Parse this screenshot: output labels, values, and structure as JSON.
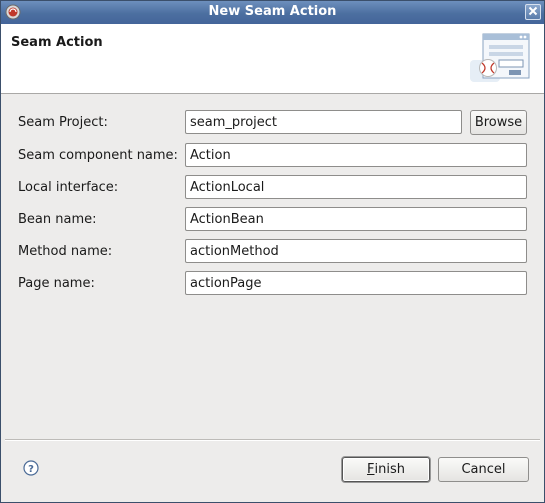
{
  "window": {
    "title": "New Seam Action"
  },
  "banner": {
    "title": "Seam Action",
    "image_icon": "seam-wizard-banner-icon"
  },
  "form": {
    "fields": [
      {
        "label": "Seam Project:",
        "value": "seam_project"
      },
      {
        "label": "Seam component name:",
        "value": "Action"
      },
      {
        "label": "Local interface:",
        "value": "ActionLocal"
      },
      {
        "label": "Bean name:",
        "value": "ActionBean"
      },
      {
        "label": "Method name:",
        "value": "actionMethod"
      },
      {
        "label": "Page name:",
        "value": "actionPage"
      }
    ],
    "browse_label": "Browse"
  },
  "footer": {
    "help_icon": "help-icon",
    "finish_mnemonic": "F",
    "finish_rest": "inish",
    "cancel_label": "Cancel"
  },
  "colors": {
    "titlebar": "#4c6fa0",
    "dialog_background": "#edeceb",
    "banner_background": "#ffffff"
  }
}
